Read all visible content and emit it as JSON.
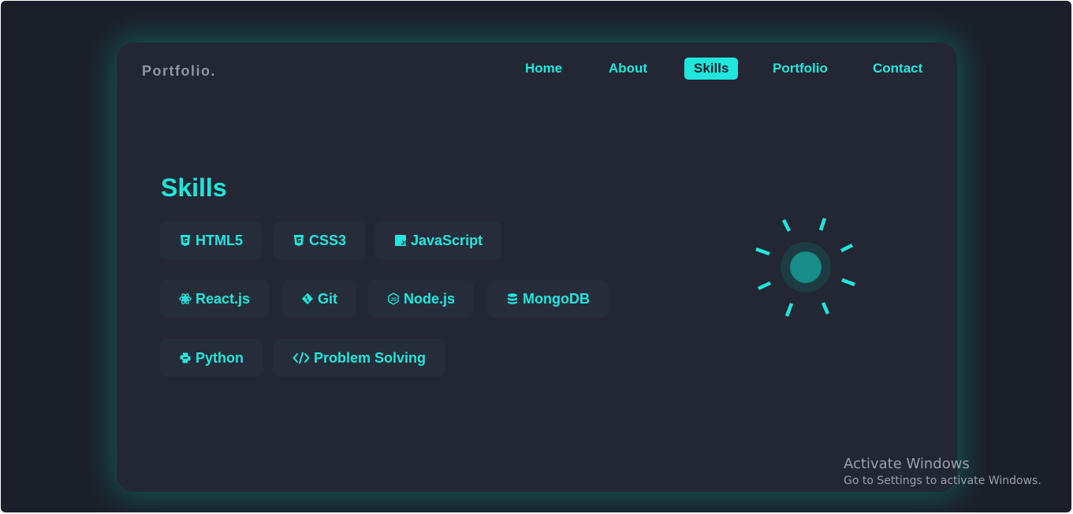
{
  "brand": "Portfolio.",
  "nav": {
    "items": [
      {
        "label": "Home"
      },
      {
        "label": "About"
      },
      {
        "label": "Skills",
        "active": true
      },
      {
        "label": "Portfolio"
      },
      {
        "label": "Contact"
      }
    ]
  },
  "section_title": "Skills",
  "skills": [
    {
      "label": "HTML5",
      "icon": "html5-icon"
    },
    {
      "label": "CSS3",
      "icon": "css3-icon"
    },
    {
      "label": "JavaScript",
      "icon": "javascript-icon"
    },
    {
      "label": "React.js",
      "icon": "react-icon"
    },
    {
      "label": "Git",
      "icon": "git-icon"
    },
    {
      "label": "Node.js",
      "icon": "nodejs-icon"
    },
    {
      "label": "MongoDB",
      "icon": "database-icon"
    },
    {
      "label": "Python",
      "icon": "python-icon"
    },
    {
      "label": "Problem Solving",
      "icon": "code-icon"
    }
  ],
  "decoration": {
    "icon": "sun-icon"
  },
  "watermark": {
    "title": "Activate Windows",
    "subtitle": "Go to Settings to activate Windows."
  },
  "colors": {
    "accent": "#1fe7dc",
    "background": "#1b1f29",
    "card": "#222733",
    "chip": "#262d3a",
    "brand_text": "#8e96a6"
  }
}
